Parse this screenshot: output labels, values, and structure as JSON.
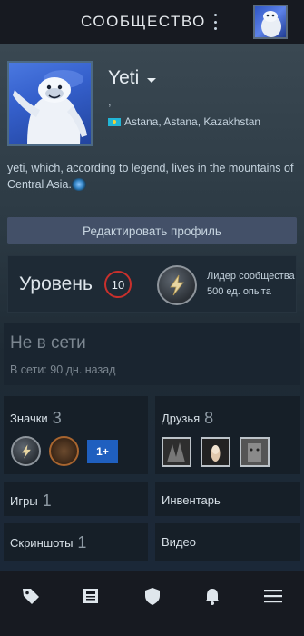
{
  "header": {
    "title": "СООБЩЕСТВО",
    "menu_icon": "kebab-menu-icon",
    "avatar_icon": "user-avatar"
  },
  "profile": {
    "name": "Yeti",
    "real_name": ",",
    "location": "Astana, Astana, Kazakhstan",
    "summary": "yeti, which, according to legend, lives in the mountains of Central Asia.",
    "edit_button": "Редактировать профиль"
  },
  "level": {
    "label": "Уровень",
    "value": "10",
    "badge_title": "Лидер сообщества",
    "badge_xp": "500 ед. опыта"
  },
  "status": {
    "title": "Не в сети",
    "last_seen": "В сети: 90 дн. назад"
  },
  "panels": {
    "badges": {
      "label": "Значки",
      "count": "3",
      "extra_badge": "1+"
    },
    "friends": {
      "label": "Друзья",
      "count": "8"
    },
    "games": {
      "label": "Игры",
      "count": "1"
    },
    "inventory": {
      "label": "Инвентарь"
    },
    "screenshots": {
      "label": "Скриншоты",
      "count": "1"
    },
    "videos": {
      "label": "Видео"
    }
  },
  "nav": [
    "tag-icon",
    "news-icon",
    "shield-icon",
    "bell-icon",
    "hamburger-menu-icon"
  ],
  "colors": {
    "accent_red": "#c9302c",
    "button": "#435068",
    "background": "#1b2838"
  }
}
